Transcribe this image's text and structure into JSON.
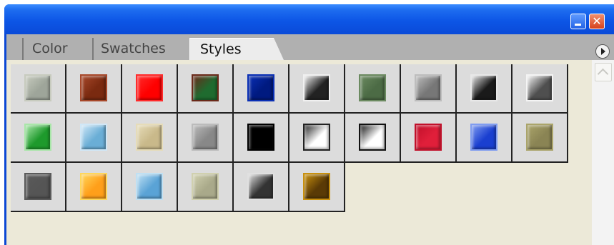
{
  "window": {
    "minimize_icon": "minimize-icon",
    "close_icon": "close-icon",
    "close_glyph": "✕"
  },
  "tabs": [
    {
      "label": "Color",
      "active": false
    },
    {
      "label": "Swatches",
      "active": false
    },
    {
      "label": "Styles",
      "active": true
    }
  ],
  "panel_menu_icon": "play-arrow-icon",
  "scrollbar": {
    "up_icon": "chevron-up-icon"
  },
  "styles": [
    {
      "name": "gray-textured",
      "colors": [
        "#9ea59a",
        "#c7cbbe"
      ]
    },
    {
      "name": "brown-bevel",
      "colors": [
        "#7a2a10",
        "#a7482a"
      ]
    },
    {
      "name": "red-glossy",
      "colors": [
        "#ff0000",
        "#ff2b2b"
      ]
    },
    {
      "name": "green-brown",
      "colors": [
        "#1f6b2f",
        "#6a2a1a"
      ]
    },
    {
      "name": "dark-blue-bevel",
      "colors": [
        "#001a80",
        "#0a2fb4"
      ]
    },
    {
      "name": "black-white-pattern",
      "colors": [
        "#222222",
        "#f0f0f0"
      ]
    },
    {
      "name": "green-textured",
      "colors": [
        "#4c6b45",
        "#6b8a60"
      ]
    },
    {
      "name": "gray-button",
      "colors": [
        "#777777",
        "#bdbdbd"
      ]
    },
    {
      "name": "bw-stripes",
      "colors": [
        "#1a1a1a",
        "#e8e8e8"
      ]
    },
    {
      "name": "dark-gray-glow",
      "colors": [
        "#4f4f4f",
        "#f4f4f4"
      ]
    },
    {
      "name": "green-gradient",
      "colors": [
        "#1e9a2c",
        "#a8e6a8"
      ]
    },
    {
      "name": "light-blue-gradient",
      "colors": [
        "#6aaed6",
        "#cfe7f7"
      ]
    },
    {
      "name": "beige-texture",
      "colors": [
        "#c9b98a",
        "#e6dcb8"
      ]
    },
    {
      "name": "gray-frame",
      "colors": [
        "#888888",
        "#bbbbbb"
      ]
    },
    {
      "name": "black-square",
      "colors": [
        "#000000",
        "#000000"
      ]
    },
    {
      "name": "white-bw-pattern",
      "colors": [
        "#ffffff",
        "#222222"
      ]
    },
    {
      "name": "white-black-frame",
      "colors": [
        "#ffffff",
        "#111111"
      ]
    },
    {
      "name": "red-stamp",
      "colors": [
        "#e01f3a",
        "#c0102a"
      ]
    },
    {
      "name": "blue-bevel",
      "colors": [
        "#1a3fd0",
        "#7f9cf0"
      ]
    },
    {
      "name": "olive-texture",
      "colors": [
        "#8a8454",
        "#aaa46a"
      ]
    },
    {
      "name": "dark-gray-square",
      "colors": [
        "#555555",
        "#5a5a5a"
      ]
    },
    {
      "name": "gold-orange",
      "colors": [
        "#ff9f1a",
        "#ffd65a"
      ]
    },
    {
      "name": "blue-light-gradient",
      "colors": [
        "#5aa3d6",
        "#bfe0f3"
      ]
    },
    {
      "name": "khaki-frame",
      "colors": [
        "#a9a98a",
        "#d0d0ae"
      ]
    },
    {
      "name": "checker-bw",
      "colors": [
        "#333333",
        "#e0e0e0"
      ]
    },
    {
      "name": "brown-gold",
      "colors": [
        "#5a3a06",
        "#c8900e"
      ]
    }
  ]
}
